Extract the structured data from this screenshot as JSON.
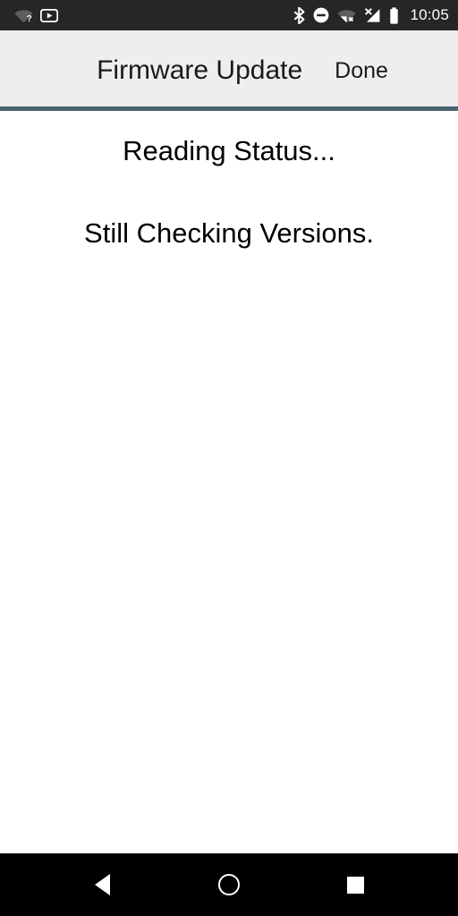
{
  "status_bar": {
    "background_color": "#262626",
    "clock": "10:05",
    "left_icons": [
      {
        "name": "wifi-unknown-icon",
        "label": "Wi-Fi status unknown"
      },
      {
        "name": "youtube-notification-icon",
        "label": "YouTube"
      }
    ],
    "right_icons": [
      {
        "name": "bluetooth-icon",
        "label": "Bluetooth on"
      },
      {
        "name": "do-not-disturb-icon",
        "label": "Do not disturb"
      },
      {
        "name": "wifi-off-icon",
        "label": "Wi-Fi disconnected"
      },
      {
        "name": "cellular-no-signal-icon",
        "label": "No cellular signal"
      },
      {
        "name": "battery-icon",
        "label": "Battery full"
      }
    ]
  },
  "title_bar": {
    "title": "Firmware Update",
    "done_label": "Done",
    "background_color": "#eeeeee",
    "divider_color": "#4a6670"
  },
  "content": {
    "background_color": "#ffffff",
    "line1": "Reading Status...",
    "line2": "Still Checking Versions."
  },
  "nav_bar": {
    "background_color": "#000000",
    "buttons": [
      {
        "name": "nav-back-button",
        "label": "Back"
      },
      {
        "name": "nav-home-button",
        "label": "Home"
      },
      {
        "name": "nav-recents-button",
        "label": "Recents"
      }
    ]
  }
}
